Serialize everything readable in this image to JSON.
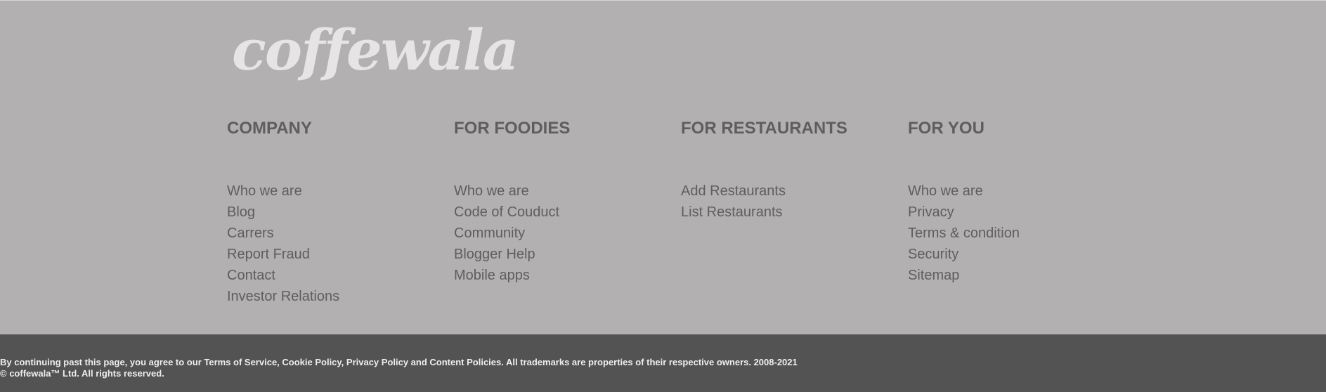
{
  "brand": {
    "logo_text": "coffewala"
  },
  "columns": [
    {
      "heading": "COMPANY",
      "links": [
        "Who we are",
        "Blog",
        "Carrers",
        "Report Fraud",
        "Contact",
        "Investor Relations"
      ]
    },
    {
      "heading": "FOR FOODIES",
      "links": [
        "Who we are",
        "Code of Couduct",
        "Community",
        "Blogger Help",
        "Mobile apps"
      ]
    },
    {
      "heading": "FOR RESTAURANTS",
      "links": [
        "Add Restaurants",
        "List Restaurants"
      ]
    },
    {
      "heading": "FOR YOU",
      "links": [
        "Who we are",
        "Privacy",
        "Terms & condition",
        "Security",
        "Sitemap"
      ]
    }
  ],
  "legal": {
    "line1": "By continuing past this page, you agree to our Terms of Service, Cookie Policy, Privacy Policy and Content Policies. All trademarks are properties of their respective owners. 2008-2021",
    "line2": "© coffewala™ Ltd. All rights reserved."
  },
  "colors": {
    "footer_background": "#b2b0b0",
    "bottom_bar_background": "#535353",
    "link_text": "#5f5d5d",
    "logo_text": "#e6e4e4"
  }
}
